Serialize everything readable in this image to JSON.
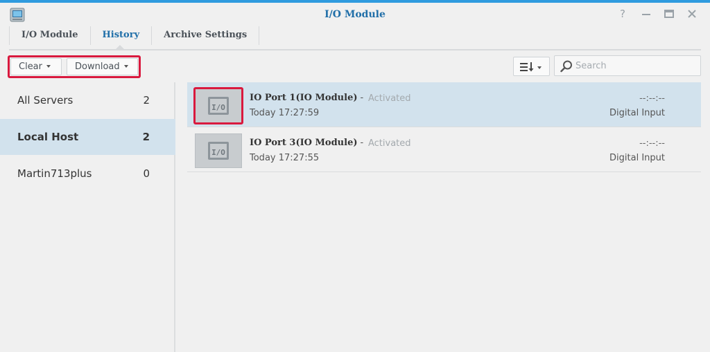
{
  "window": {
    "title": "I/O Module",
    "icon": "io-module-app-icon",
    "controls": [
      "help-icon",
      "minimize-icon",
      "maximize-icon",
      "close-icon"
    ]
  },
  "tabs": [
    {
      "label": "I/O Module",
      "active": false
    },
    {
      "label": "History",
      "active": true
    },
    {
      "label": "Archive Settings",
      "active": false
    }
  ],
  "toolbar": {
    "clear_label": "Clear",
    "download_label": "Download",
    "sort_icon": "sort-list-icon",
    "search_placeholder": "Search",
    "search_value": ""
  },
  "sidebar": {
    "items": [
      {
        "label": "All Servers",
        "count": "2",
        "active": false
      },
      {
        "label": "Local Host",
        "count": "2",
        "active": true
      },
      {
        "label": "Martin713plus",
        "count": "0",
        "active": false
      }
    ]
  },
  "events": [
    {
      "title": "IO Port 1(IO Module)",
      "separator": "-",
      "status": "Activated",
      "time": "Today 17:27:59",
      "value": "--:--:--",
      "type": "Digital Input",
      "selected": true
    },
    {
      "title": "IO Port 3(IO Module)",
      "separator": "-",
      "status": "Activated",
      "time": "Today 17:27:55",
      "value": "--:--:--",
      "type": "Digital Input",
      "selected": false
    }
  ],
  "colors": {
    "accent": "#1f6ea8",
    "selection": "#d2e2ed",
    "highlight": "#d9193e"
  }
}
